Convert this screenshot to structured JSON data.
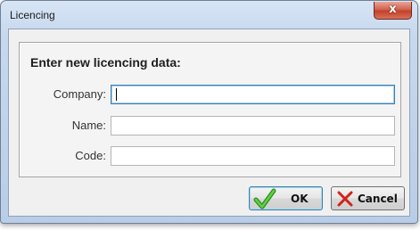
{
  "window": {
    "title": "Licencing",
    "close_label": "x"
  },
  "form": {
    "heading": "Enter new licencing data:",
    "fields": [
      {
        "label": "Company:",
        "value": "",
        "focused": true
      },
      {
        "label": "Name:",
        "value": "",
        "focused": false
      },
      {
        "label": "Code:",
        "value": "",
        "focused": false
      }
    ]
  },
  "buttons": {
    "ok": {
      "label": "OK",
      "icon": "checkmark-icon",
      "icon_color": "#3aa827"
    },
    "cancel": {
      "label": "Cancel",
      "icon": "cross-icon",
      "icon_color": "#d0241a"
    }
  }
}
